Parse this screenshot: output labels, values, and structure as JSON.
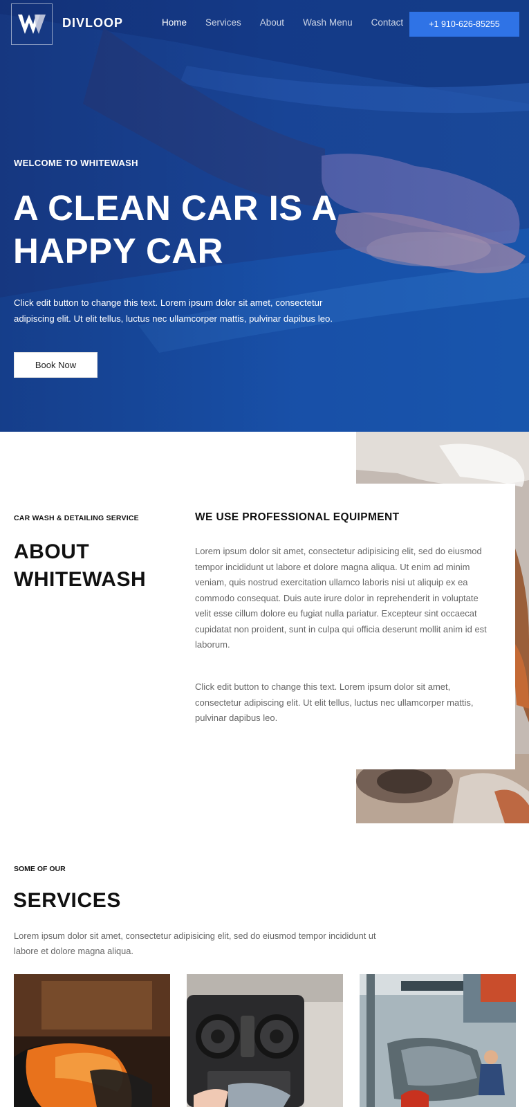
{
  "brand": {
    "name": "DIVLOOP",
    "logo_letter": "W"
  },
  "nav": {
    "items": [
      {
        "label": "Home",
        "active": true
      },
      {
        "label": "Services",
        "active": false
      },
      {
        "label": "About",
        "active": false
      },
      {
        "label": "Wash Menu",
        "active": false
      },
      {
        "label": "Contact",
        "active": false
      }
    ],
    "phone_label": "+1 910-626-85255"
  },
  "hero": {
    "eyebrow": "WELCOME TO WHITEWASH",
    "title": "A CLEAN CAR IS A HAPPY CAR",
    "text": "Click edit button to change this text. Lorem ipsum dolor sit amet, consectetur adipiscing elit. Ut elit tellus, luctus nec ullamcorper mattis, pulvinar dapibus leo.",
    "button_label": "Book Now",
    "image": "hand-washing-car-photo"
  },
  "about": {
    "eyebrow": "CAR WASH & DETAILING SERVICE",
    "title": "ABOUT WHITEWASH",
    "subtitle": "WE USE PROFESSIONAL EQUIPMENT",
    "paragraph_1": "Lorem ipsum dolor sit amet, consectetur adipisicing elit, sed do eiusmod tempor incididunt ut labore et dolore magna aliqua. Ut enim ad minim veniam, quis nostrud exercitation ullamco laboris nisi ut aliquip ex ea commodo consequat. Duis aute irure dolor in reprehenderit in voluptate velit esse cillum dolore eu fugiat nulla pariatur. Excepteur sint occaecat cupidatat non proident, sunt in culpa qui officia deserunt mollit anim id est laborum.",
    "paragraph_2": "Click edit button to change this text. Lorem ipsum dolor sit amet, consectetur adipiscing elit. Ut elit tellus, luctus nec ullamcorper mattis, pulvinar dapibus leo.",
    "image": "car-detailing-photo"
  },
  "services": {
    "eyebrow": "SOME OF OUR",
    "title": "SERVICES",
    "text": "Lorem ipsum dolor sit amet, consectetur adipisicing elit, sed do eiusmod tempor incididunt ut labore et dolore magna aliqua.",
    "cards": [
      {
        "image": "orange-cloth-wash-photo"
      },
      {
        "image": "dashboard-cleaning-photo"
      },
      {
        "image": "pressure-wash-photo"
      }
    ]
  },
  "colors": {
    "hero_blue": "#1a4a9c",
    "accent_blue": "#2f73e6",
    "white": "#ffffff",
    "text_dark": "#111111",
    "text_muted": "#666666"
  }
}
